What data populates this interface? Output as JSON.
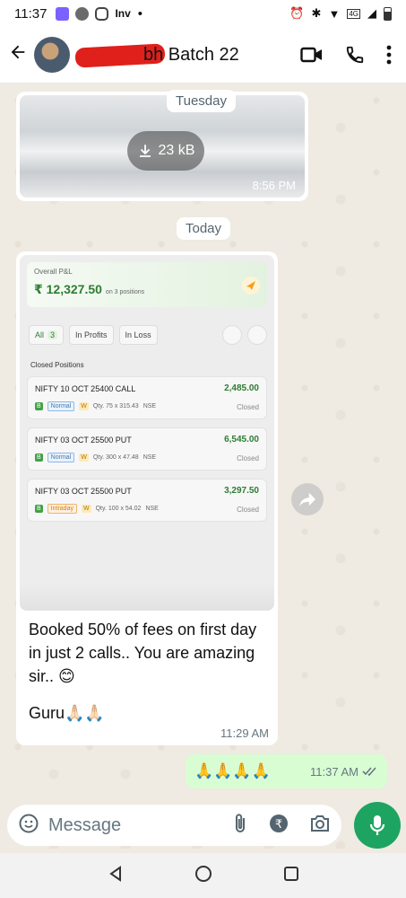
{
  "status_bar": {
    "time": "11:37",
    "brand_text": "Inv",
    "dot": "•",
    "icon_colors": [
      "#7b61ff",
      "#6b6b6b",
      "#444444"
    ]
  },
  "header": {
    "title": "bh Batch 22",
    "back_icon": "arrow-left-icon",
    "icons": [
      "video-call-icon",
      "phone-icon",
      "more-vertical-icon"
    ]
  },
  "messages": {
    "image_msg": {
      "size": "23 kB",
      "time": "8:56 PM"
    },
    "day_tuesday": "Tuesday",
    "day_today": "Today",
    "screenshot": {
      "pnl_label": "Overall P&L",
      "pnl_value": "₹ 12,327.50",
      "pnl_sub": "on 3 positions",
      "filters": [
        {
          "label": "All",
          "count": "3"
        },
        {
          "label": "In Profits"
        },
        {
          "label": "In Loss"
        }
      ],
      "closed_title": "Closed Positions",
      "positions": [
        {
          "name": "NIFTY 10 OCT 25400 CALL",
          "value": "2,485.00",
          "type": "Normal",
          "qty": "Qty. 75 x 315.43",
          "exchange": "NSE",
          "status": "Closed"
        },
        {
          "name": "NIFTY 03 OCT 25500 PUT",
          "value": "6,545.00",
          "type": "Normal",
          "qty": "Qty. 300 x 47.48",
          "exchange": "NSE",
          "status": "Closed"
        },
        {
          "name": "NIFTY 03 OCT 25500 PUT",
          "value": "3,297.50",
          "type": "Intraday",
          "qty": "Qty. 100 x 54.02",
          "exchange": "NSE",
          "status": "Closed"
        }
      ],
      "b_label": "B",
      "w_label": "W"
    },
    "caption": "Booked 50% of fees on first day in just 2 calls.. You are amazing sir.. 😊",
    "caption_2": "Guru🙏🏻🙏🏻",
    "time": "11:29 AM",
    "outgoing": {
      "text": "🙏🙏🙏🙏",
      "time": "11:37 AM"
    }
  },
  "composer": {
    "placeholder": "Message"
  },
  "colors": {
    "accent": "#1da461",
    "outgoing_bubble": "#d9fdd3",
    "chat_bg": "#efeae2",
    "profit": "#2e7d32"
  }
}
